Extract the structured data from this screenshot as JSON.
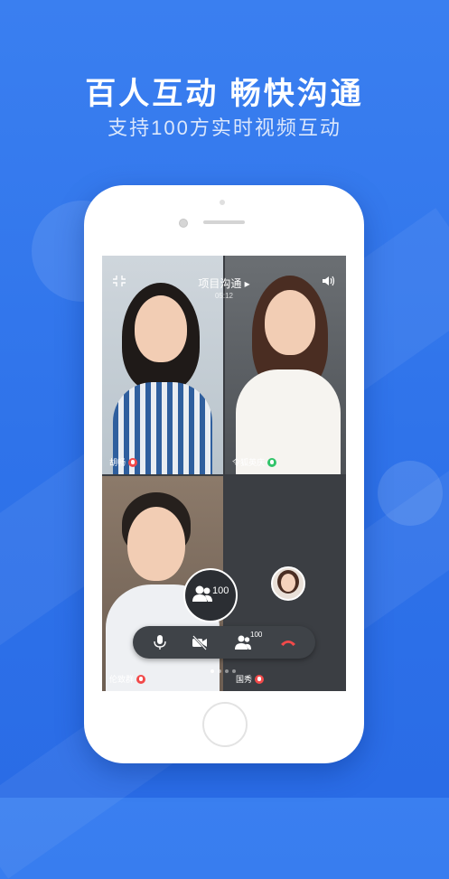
{
  "promo": {
    "headline": "百人互动 畅快沟通",
    "subline": "支持100方实时视频互动"
  },
  "call": {
    "title": "项目沟通 ▸",
    "timer": "05:12",
    "members_count": "100",
    "controls_count": "100"
  },
  "participants": [
    {
      "name": "胡畅",
      "mic": "muted"
    },
    {
      "name": "令狐英庆",
      "mic": "on"
    },
    {
      "name": "伦致群",
      "mic": "muted"
    },
    {
      "name": "国秀",
      "mic": "muted"
    }
  ],
  "icons": {
    "minimize": "shrink-icon",
    "speaker": "speaker-icon",
    "mic": "mic-icon",
    "camera_off": "camera-off-icon",
    "members": "members-icon",
    "hangup": "hangup-icon"
  },
  "colors": {
    "background": "#2f73ea",
    "hangup": "#f24a4a",
    "mic_on": "#31c46a"
  }
}
